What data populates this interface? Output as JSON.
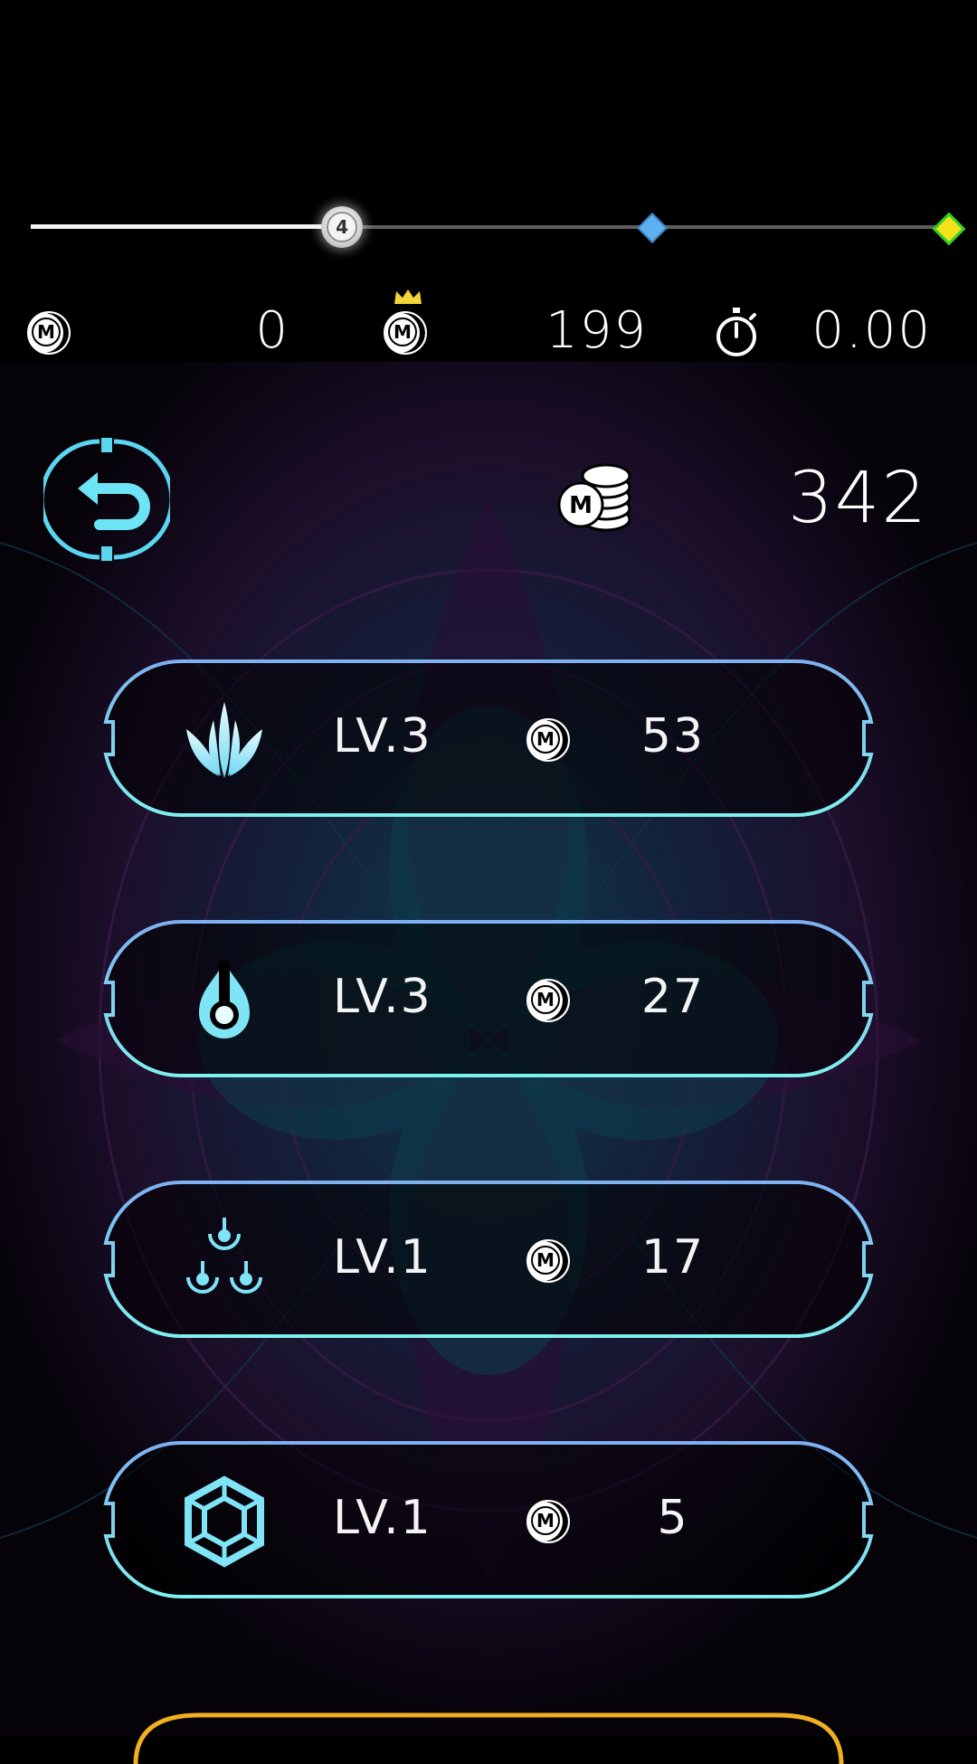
{
  "progress": {
    "current_stage": "4",
    "fraction": 0.34
  },
  "stats": {
    "coins": "0",
    "best_coins": "199",
    "time": "0.00"
  },
  "total_coins": "342",
  "upgrades": [
    {
      "icon": "spikes-icon",
      "level": "LV.3",
      "cost": "53"
    },
    {
      "icon": "flame-orb-icon",
      "level": "LV.3",
      "cost": "27"
    },
    {
      "icon": "triple-orb-icon",
      "level": "LV.1",
      "cost": "17"
    },
    {
      "icon": "hexagon-shield-icon",
      "level": "LV.1",
      "cost": "5"
    }
  ],
  "colors": {
    "frame_top": "#7fb0f2",
    "frame_bottom": "#7ff0ee",
    "accent_cyan": "#5ad6f0",
    "bottom_button": "#f0b020",
    "crown": "#f4d43a"
  }
}
